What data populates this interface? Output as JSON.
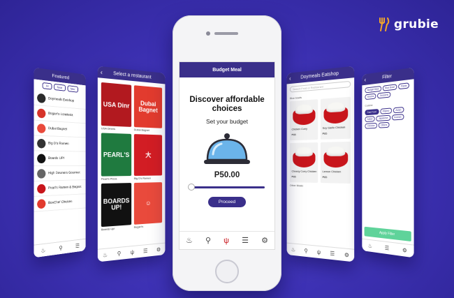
{
  "brand": {
    "name": "grubie",
    "accent": "#f2a52b"
  },
  "colors": {
    "primary": "#3a2f8a",
    "background": "#3d31b4",
    "red": "#c8151b",
    "apply": "#5fd39a"
  },
  "phone1": {
    "title": "Featured",
    "tabs": [
      "All",
      "Near",
      "New"
    ],
    "restaurants": [
      {
        "name": "Doymeals Eatshop",
        "color": "#2b2b2b"
      },
      {
        "name": "Bogart's Lomiteria",
        "color": "#d7342a"
      },
      {
        "name": "Dubai Bagnet",
        "color": "#e94a3c"
      },
      {
        "name": "Big D's Ramen",
        "color": "#333"
      },
      {
        "name": "Boards UP!",
        "color": "#111"
      },
      {
        "name": "High Downers Gourmet",
        "color": "#666"
      },
      {
        "name": "Pearl's Ramen & Bagnet",
        "color": "#c8151b"
      },
      {
        "name": "BonChef Chicken",
        "color": "#e23b2e"
      }
    ]
  },
  "phone2": {
    "title": "Select a restaurant",
    "cells": [
      {
        "label": "USA Dinr",
        "caption": "USA Diners",
        "color": "#b2191f"
      },
      {
        "label": "Dubai Bagnet",
        "caption": "Dubai Bagnet",
        "color": "#e23b2e"
      },
      {
        "label": "PEARL'S",
        "caption": "Pearl's Pizza",
        "color": "#1f7a3f"
      },
      {
        "label": "大",
        "caption": "Big D's Ramen",
        "color": "#d21d24"
      },
      {
        "label": "BOARDS UP!",
        "caption": "Boards Up!",
        "color": "#111"
      },
      {
        "label": "☺",
        "caption": "Bogart's",
        "color": "#e94a3c"
      }
    ]
  },
  "phone4": {
    "title": "Doymeals Eatshop",
    "search_placeholder": "Search Food or Restaurant",
    "section1": "Rice bowls",
    "section2": "Other Meals",
    "dishes": [
      {
        "name": "Chicken Curry",
        "price": "₱85"
      },
      {
        "name": "Soy Garlic Chicken",
        "price": "₱85"
      },
      {
        "name": "Cheesy Curry Chicken",
        "price": "₱85"
      },
      {
        "name": "Lemon Chicken",
        "price": "₱85"
      }
    ]
  },
  "phone5": {
    "title": "Filter",
    "chips_top": [
      "Budget Meal",
      "Rice Bowl",
      "Pasta",
      "Snacks",
      "Desserts"
    ],
    "label": "Cuisine",
    "chips": [
      "Fast Food",
      "Filipino",
      "Asian",
      "Italian",
      "Japanese",
      "Korean",
      "Chinese",
      "Others"
    ],
    "apply": "Apply Filter"
  },
  "main": {
    "title": "Budget Meal",
    "headline": "Discover affordable choices",
    "subtitle": "Set your budget",
    "budget": "P50.00",
    "budget_level": 0.0,
    "proceed": "Proceed"
  }
}
